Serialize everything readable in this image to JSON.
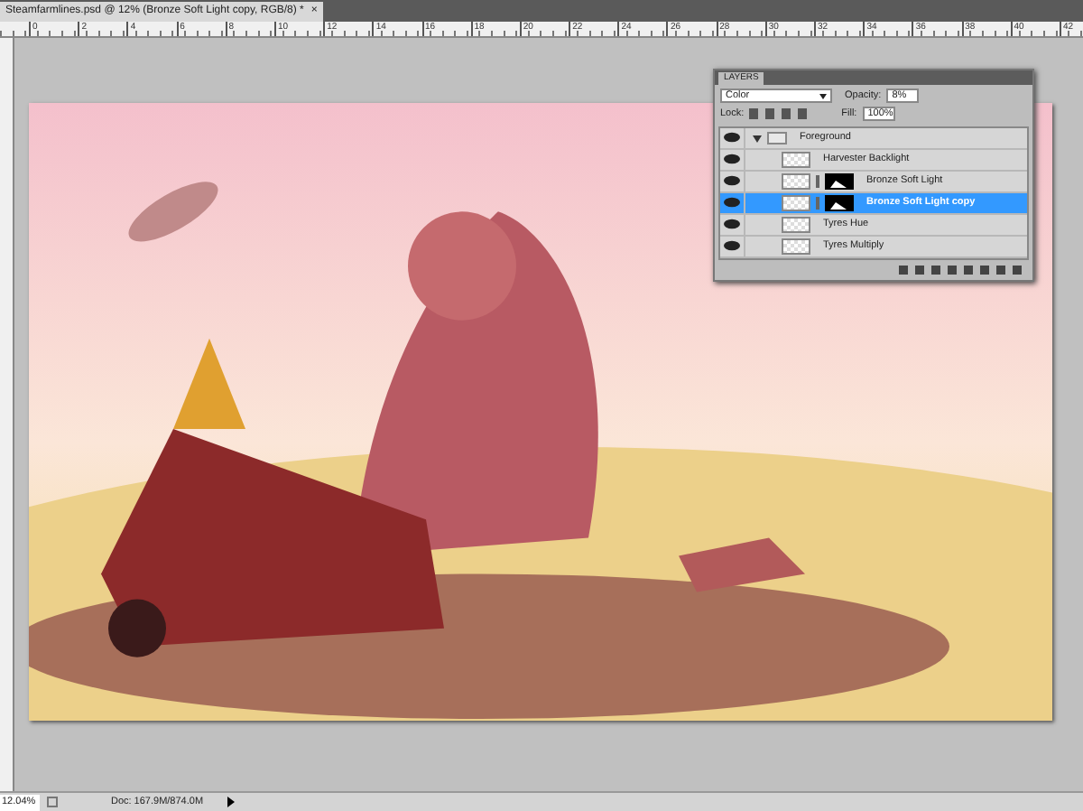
{
  "document_tab": {
    "title": "Steamfarmlines.psd @ 12% (Bronze Soft Light copy, RGB/8) *",
    "close": "×"
  },
  "ruler": {
    "labels": [
      "0",
      "2",
      "4",
      "6",
      "8",
      "10",
      "12",
      "14",
      "16",
      "18",
      "20",
      "22",
      "24",
      "26",
      "28",
      "30",
      "32",
      "34",
      "36",
      "38",
      "40",
      "42"
    ]
  },
  "layers_panel": {
    "title": "LAYERS",
    "blend_mode": "Color",
    "opacity_label": "Opacity:",
    "opacity": "8%",
    "lock_label": "Lock:",
    "fill_label": "Fill:",
    "fill": "100%",
    "layers": [
      {
        "name": "Foreground",
        "kind": "group",
        "expanded": true,
        "visible": true,
        "selected": false,
        "children": [
          {
            "name": "Harvester Backlight",
            "kind": "layer",
            "visible": true,
            "selected": false
          },
          {
            "name": "Bronze Soft Light",
            "kind": "masked",
            "visible": true,
            "selected": false
          },
          {
            "name": "Bronze Soft Light copy",
            "kind": "masked",
            "visible": true,
            "selected": true
          },
          {
            "name": "Tyres Hue",
            "kind": "layer",
            "visible": true,
            "selected": false
          },
          {
            "name": "Tyres Multiply",
            "kind": "layer",
            "visible": true,
            "selected": false
          }
        ]
      }
    ]
  },
  "status_bar": {
    "zoom": "12.04%",
    "doc": "Doc: 167.9M/874.0M"
  }
}
